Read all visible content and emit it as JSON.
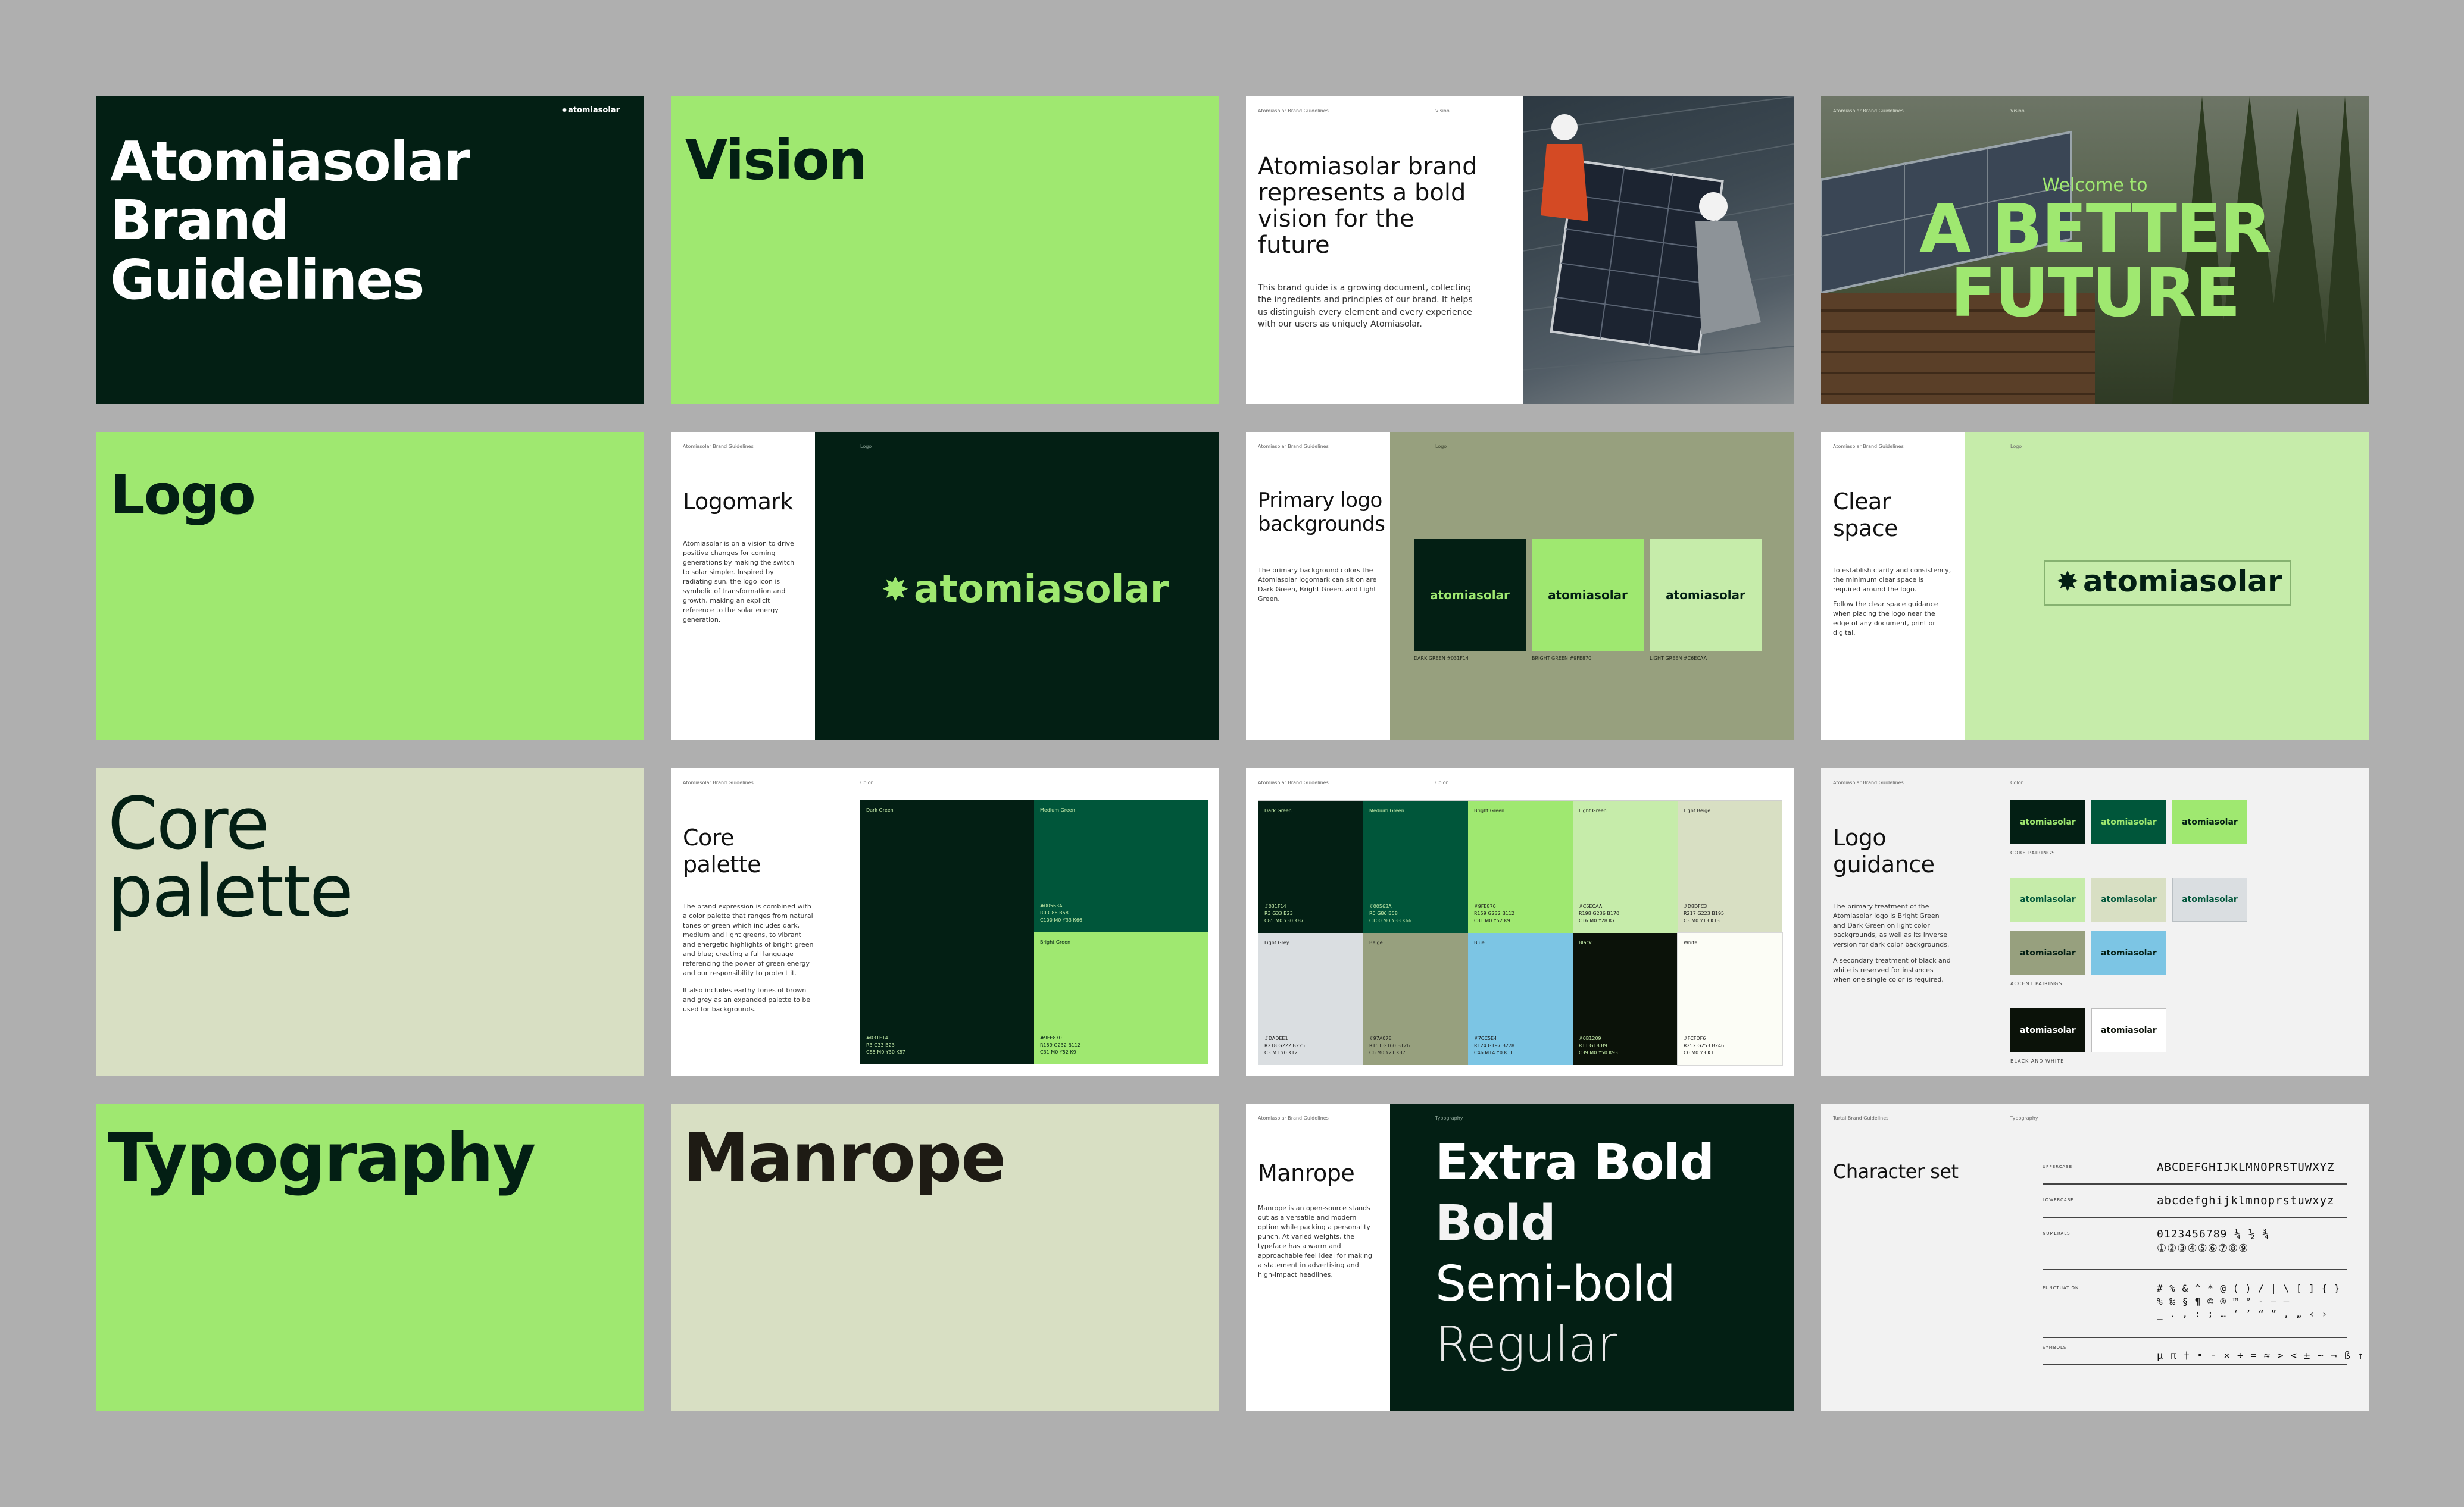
{
  "brand": "atomiasolar",
  "colors": {
    "dark_green": "#031F14",
    "medium_green": "#00563A",
    "bright_green": "#9FE870",
    "light_green": "#C6ECAA",
    "beige": "#D8DFC3",
    "light_grey": "#DADEE1",
    "olive": "#97A07E",
    "blue": "#7CC5E4",
    "black": "#0B1209",
    "white": "#FCFDF6",
    "board": "#AFAFAF"
  },
  "slides": {
    "s1": {
      "title": "Atomiasolar Brand Guidelines",
      "logo": "atomiasolar"
    },
    "s2": {
      "title": "Vision"
    },
    "s3": {
      "meta_left": "Atomiasolar Brand Guidelines",
      "meta_right": "Vision",
      "heading": "Atomiasolar brand represents a bold vision for the future",
      "body": "This brand guide is a growing document, collecting the ingredients and principles of our brand. It helps us distinguish every element and every experience with our users as uniquely Atomiasolar."
    },
    "s4": {
      "meta_left": "Atomiasolar Brand Guidelines",
      "meta_right": "Vision",
      "kicker": "Welcome to",
      "headline": "A BETTER FUTURE"
    },
    "s5": {
      "title": "Logo"
    },
    "s6": {
      "meta_left": "Atomiasolar Brand Guidelines",
      "meta_right": "Logo",
      "heading": "Logomark",
      "body": "Atomiasolar is on a vision to drive positive changes for coming generations by making the switch to solar simpler. Inspired by radiating sun, the logo icon is symbolic of transformation and growth, making an explicit reference to the solar energy generation.",
      "wordmark": "atomiasolar"
    },
    "s7": {
      "meta_left": "Atomiasolar Brand Guidelines",
      "meta_right": "Logo",
      "heading": "Primary logo backgrounds",
      "body": "The primary background colors the Atomiasolar logomark can sit on are Dark Green, Bright Green, and Light Green.",
      "cards": [
        {
          "logo": "atomiasolar",
          "label": "DARK GREEN #031F14"
        },
        {
          "logo": "atomiasolar",
          "label": "BRIGHT GREEN #9FE870"
        },
        {
          "logo": "atomiasolar",
          "label": "LIGHT GREEN #C6ECAA"
        }
      ]
    },
    "s8": {
      "meta_left": "Atomiasolar Brand Guidelines",
      "meta_right": "Logo",
      "heading": "Clear space",
      "body1": "To establish clarity and consistency, the minimum clear space is required around the logo.",
      "body2": "Follow the clear space guidance when placing the logo near the edge of any document, print or digital.",
      "wordmark": "atomiasolar"
    },
    "s9": {
      "title": "Core palette"
    },
    "s10": {
      "meta_left": "Atomiasolar Brand Guidelines",
      "meta_right": "Color",
      "heading": "Core palette",
      "body1": "The brand expression is combined with a color palette that ranges from natural tones of green which includes dark, medium and light greens, to vibrant and energetic highlights of bright green and blue; creating a full language referencing the power of green energy and our responsibility to protect it.",
      "body2": "It also includes earthy tones of brown and grey as an expanded palette to be used for backgrounds.",
      "swatches": [
        {
          "name": "Dark Green",
          "hex": "#031F14",
          "rgb": "R3 G33 B23",
          "cmyk": "C85 M0 Y30 K87"
        },
        {
          "name": "Medium Green",
          "hex": "#00563A",
          "rgb": "R0 G86 B58",
          "cmyk": "C100 M0 Y33 K66"
        },
        {
          "name": "Bright Green",
          "hex": "#9FE870",
          "rgb": "R159 G232 B112",
          "cmyk": "C31 M0 Y52 K9"
        }
      ]
    },
    "s11": {
      "meta_left": "Atomiasolar Brand Guidelines",
      "meta_right": "Color",
      "swatches": [
        {
          "name": "Dark Green",
          "hex": "#031F14",
          "rgb": "R3 G33 B23",
          "cmyk": "C85 M0 Y30 K87"
        },
        {
          "name": "Medium Green",
          "hex": "#00563A",
          "rgb": "R0 G86 B58",
          "cmyk": "C100 M0 Y33 K66"
        },
        {
          "name": "Bright Green",
          "hex": "#9FE870",
          "rgb": "R159 G232 B112",
          "cmyk": "C31 M0 Y52 K9"
        },
        {
          "name": "Light Green",
          "hex": "#C6ECAA",
          "rgb": "R198 G236 B170",
          "cmyk": "C16 M0 Y28 K7"
        },
        {
          "name": "Light Beige",
          "hex": "#D8DFC3",
          "rgb": "R217 G223 B195",
          "cmyk": "C3 M0 Y13 K13"
        },
        {
          "name": "Light Grey",
          "hex": "#DADEE1",
          "rgb": "R218 G222 B225",
          "cmyk": "C3 M1 Y0 K12"
        },
        {
          "name": "Beige",
          "hex": "#97A07E",
          "rgb": "R151 G160 B126",
          "cmyk": "C6 M0 Y21 K37"
        },
        {
          "name": "Blue",
          "hex": "#7CC5E4",
          "rgb": "R124 G197 B228",
          "cmyk": "C46 M14 Y0 K11"
        },
        {
          "name": "Black",
          "hex": "#0B1209",
          "rgb": "R11 G18 B9",
          "cmyk": "C39 M0 Y50 K93"
        },
        {
          "name": "White",
          "hex": "#FCFDF6",
          "rgb": "R252 G253 B246",
          "cmyk": "C0 M0 Y3 K1"
        }
      ]
    },
    "s12": {
      "meta_left": "Atomiasolar Brand Guidelines",
      "meta_right": "Color",
      "heading": "Logo guidance",
      "body1": "The primary treatment of the Atomiasolar logo is Bright Green and Dark Green on light color backgrounds, as well as its inverse version for dark color backgrounds.",
      "body2": "A secondary treatment of black and white is reserved for instances when one single color is required.",
      "pill_text": "atomiasolar",
      "label_core": "CORE PAIRINGS",
      "label_accent": "ACCENT PAIRINGS",
      "label_bw": "BLACK AND WHITE"
    },
    "s13": {
      "title": "Typography"
    },
    "s14": {
      "title": "Manrope"
    },
    "s15": {
      "meta_left": "Atomiasolar Brand Guidelines",
      "meta_right": "Typography",
      "heading": "Manrope",
      "body": "Manrope is an open-source stands out as a versatile and modern option while packing a personality punch. At varied weights, the typeface has a warm and approachable feel ideal for making a statement in advertising and high-impact headlines.",
      "weights": [
        "Extra Bold",
        "Bold",
        "Semi-bold",
        "Regular"
      ]
    },
    "s16": {
      "meta_left": "Turtai Brand Guidelines",
      "meta_right": "Typography",
      "heading": "Character set",
      "rows": [
        {
          "label": "UPPERCASE",
          "value": "ABCDEFGHIJKLMNOPRSTUWXYZ"
        },
        {
          "label": "LOWERCASE",
          "value": "abcdefghijklmnoprstuwxyz"
        },
        {
          "label": "NUMERALS",
          "value": "0123456789 ¼ ½ ¾\n①②③④⑤⑥⑦⑧⑨"
        },
        {
          "label": "PUNCTUATION",
          "value": "# % & ^ * @ ( ) / | \\ [ ] { }\n% ‰ § ¶ © ® ™ ° - – —\n_ . , : ; … ‘ ’ “ ” ‚ „ ‹ ›"
        },
        {
          "label": "SYMBOLS",
          "value": "µ π † • - × ÷ = ≈ > < ± ~ ¬ ß ↑ → ↓ ←"
        }
      ]
    }
  }
}
